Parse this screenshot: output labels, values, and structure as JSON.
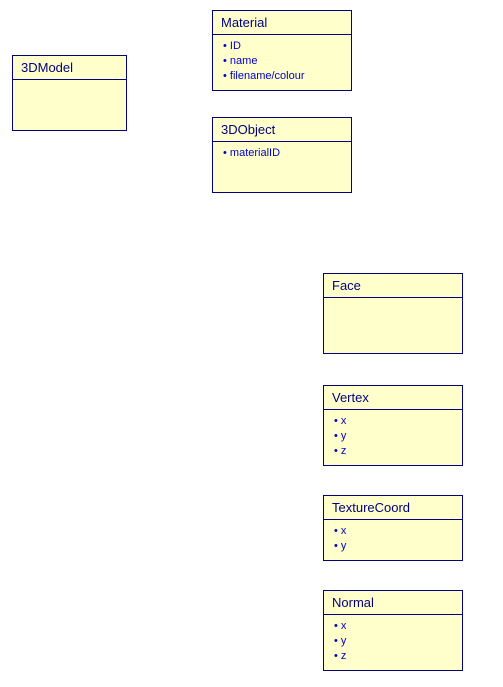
{
  "boxes": {
    "model": {
      "title": "3DModel",
      "attrs": []
    },
    "material": {
      "title": "Material",
      "attrs": [
        "ID",
        "name",
        "filename/colour"
      ]
    },
    "object": {
      "title": "3DObject",
      "attrs": [
        "materialID"
      ]
    },
    "face": {
      "title": "Face",
      "attrs": []
    },
    "vertex": {
      "title": "Vertex",
      "attrs": [
        "x",
        "y",
        "z"
      ]
    },
    "texcoord": {
      "title": "TextureCoord",
      "attrs": [
        "x",
        "y"
      ]
    },
    "normal": {
      "title": "Normal",
      "attrs": [
        "x",
        "y",
        "z"
      ]
    }
  }
}
